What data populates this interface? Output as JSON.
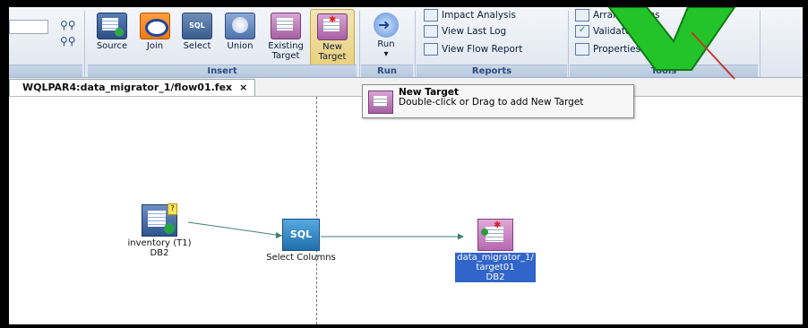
{
  "ribbon": {
    "insert": {
      "label": "Insert",
      "buttons": [
        {
          "id": "source",
          "label": "Source",
          "icon": "db-source-icon"
        },
        {
          "id": "join",
          "label": "Join",
          "icon": "join-icon"
        },
        {
          "id": "select",
          "label": "Select",
          "icon": "sql-icon"
        },
        {
          "id": "union",
          "label": "Union",
          "icon": "union-icon"
        },
        {
          "id": "existing_target",
          "label": "Existing\nTarget",
          "icon": "existing-target-icon"
        },
        {
          "id": "new_target",
          "label": "New\nTarget",
          "icon": "new-target-icon"
        }
      ]
    },
    "run": {
      "label": "Run",
      "button_label": "Run",
      "dropdown": "▾"
    },
    "reports": {
      "label": "Reports",
      "items": [
        "Impact Analysis",
        "View Last Log",
        "View Flow Report"
      ]
    },
    "tools": {
      "label": "Tools",
      "items": [
        "Arrange Items",
        "Validate",
        "Properties"
      ]
    }
  },
  "tab": {
    "title": "WQLPAR4:data_migrator_1/flow01.fex",
    "close": "×"
  },
  "tooltip": {
    "title": "New Target",
    "description": "Double-click or Drag to add New Target"
  },
  "nodes": {
    "source": {
      "name": "inventory (T1)",
      "type": "DB2"
    },
    "sql": {
      "badge": "SQL",
      "name": "Select Columns"
    },
    "target": {
      "line1": "data_migrator_1/",
      "line2": "target01",
      "line3": "DB2"
    }
  },
  "colors": {
    "accent_green": "#22c42a",
    "selection_blue": "#3265c9",
    "sql_blue": "#2e88c8",
    "target_pink": "#c486c0"
  }
}
